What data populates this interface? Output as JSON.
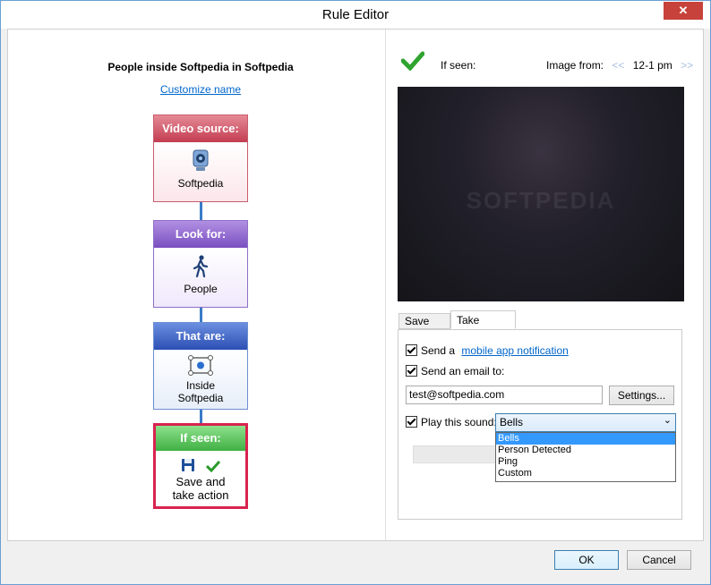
{
  "window": {
    "title": "Rule Editor",
    "close_glyph": "✕"
  },
  "left": {
    "rule_title": "People inside Softpedia in Softpedia",
    "customize_link": "Customize name",
    "cards": {
      "video": {
        "header": "Video source:",
        "label": "Softpedia",
        "icon": "webcam-icon"
      },
      "look": {
        "header": "Look for:",
        "label": "People",
        "icon": "walking-person-icon"
      },
      "that": {
        "header": "That are:",
        "label_line1": "Inside",
        "label_line2": "Softpedia",
        "icon": "zone-icon"
      },
      "seen": {
        "header": "If seen:",
        "label_line1": "Save and",
        "label_line2": "take action",
        "icons": [
          "floppy-disk-icon",
          "checkmark-icon"
        ]
      }
    }
  },
  "right": {
    "if_seen_label": "If seen:",
    "image_from_label": "Image from:",
    "prev_glyph": "<<",
    "next_glyph": ">>",
    "time_range": "12-1 pm",
    "preview_watermark": "SOFTPEDIA",
    "tabs": [
      {
        "label": "Save clips",
        "active": false
      },
      {
        "label": "Take actions",
        "active": true
      }
    ],
    "actions": {
      "send_a_label": "Send a",
      "mobile_link": "mobile app notification",
      "send_email_label": "Send an email to:",
      "email_value": "test@softpedia.com",
      "settings_button": "Settings...",
      "play_sound_label": "Play this sound:",
      "sound_selected": "Bells",
      "sound_options": [
        "Bells",
        "Person Detected",
        "Ping",
        "Custom"
      ],
      "dropdown_arrow": "⌄"
    }
  },
  "footer": {
    "ok": "OK",
    "cancel": "Cancel"
  },
  "colors": {
    "accent_blue": "#3a7bc8",
    "video_red": "#c33c50",
    "look_purple": "#7a4fc0",
    "that_blue": "#2c4fb4",
    "seen_green": "#3fb043",
    "selection_blue": "#3399ff"
  }
}
